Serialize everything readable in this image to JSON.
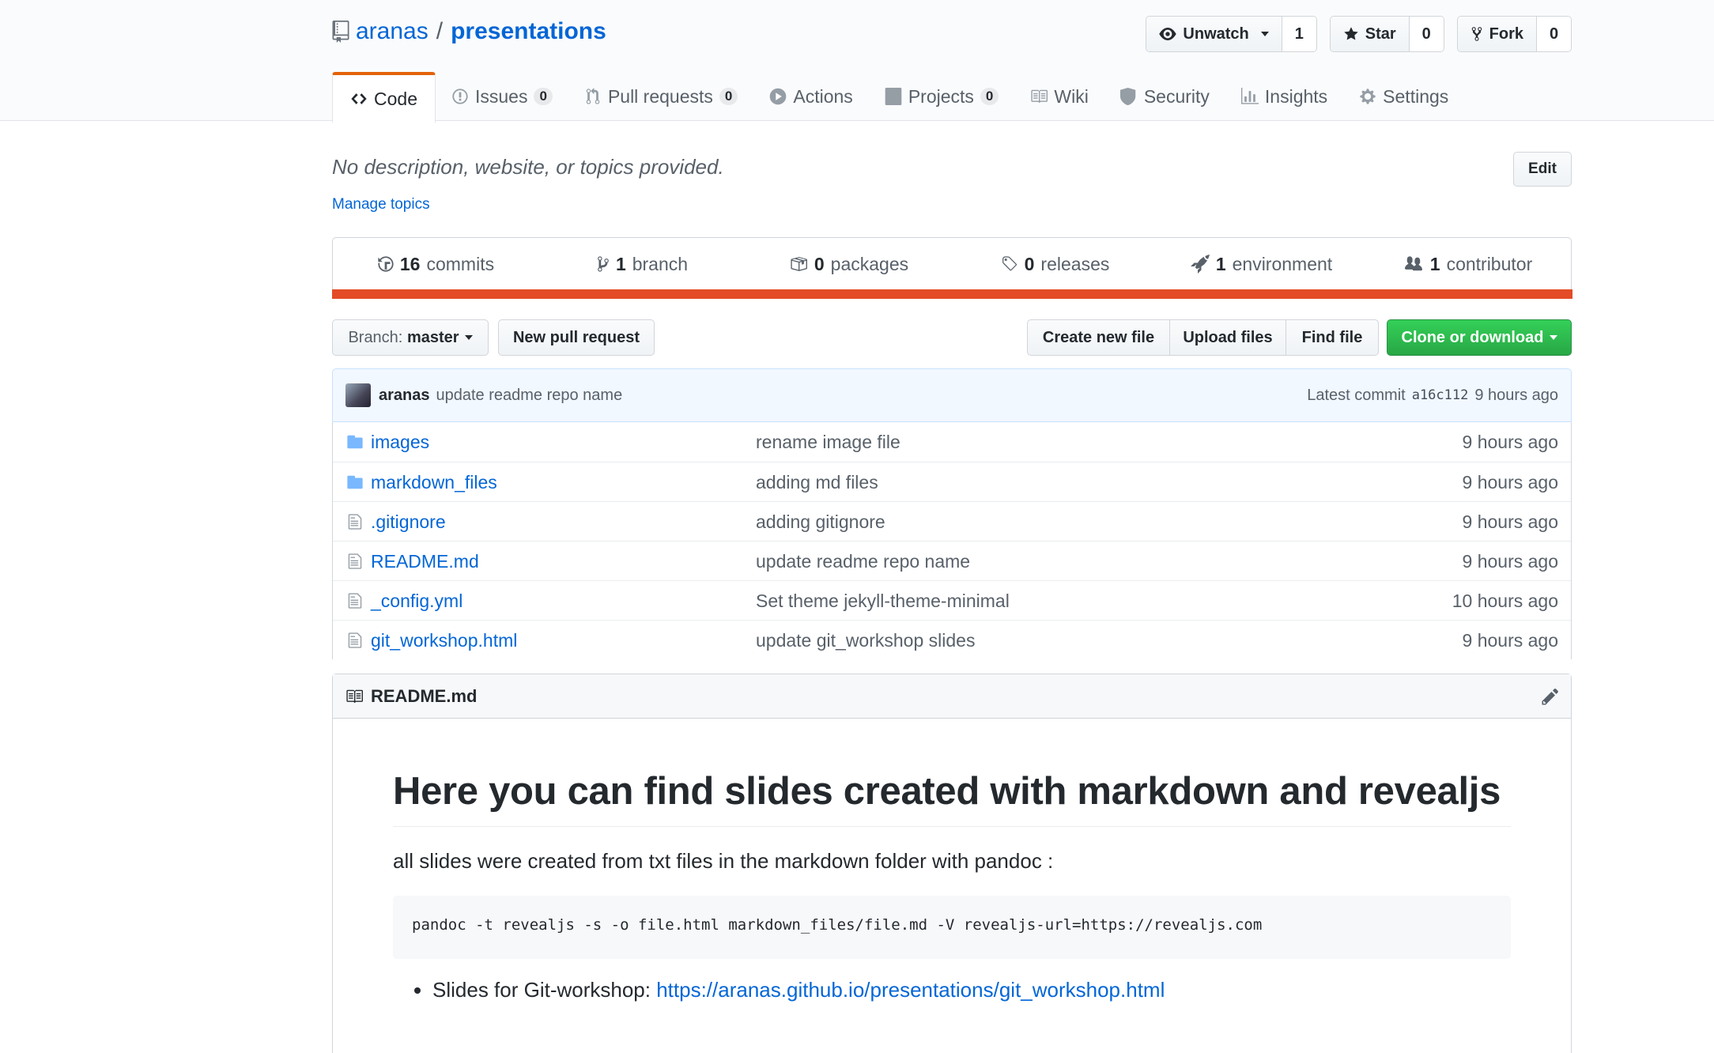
{
  "repo": {
    "owner": "aranas",
    "separator": "/",
    "name": "presentations"
  },
  "actions": {
    "watch": {
      "label": "Unwatch",
      "count": "1"
    },
    "star": {
      "label": "Star",
      "count": "0"
    },
    "fork": {
      "label": "Fork",
      "count": "0"
    }
  },
  "nav": {
    "code": "Code",
    "issues": "Issues",
    "issues_count": "0",
    "pulls": "Pull requests",
    "pulls_count": "0",
    "actions": "Actions",
    "projects": "Projects",
    "projects_count": "0",
    "wiki": "Wiki",
    "security": "Security",
    "insights": "Insights",
    "settings": "Settings"
  },
  "description": "No description, website, or topics provided.",
  "manage_topics": "Manage topics",
  "edit_label": "Edit",
  "summary": {
    "commits_num": "16",
    "commits_label": "commits",
    "branch_num": "1",
    "branch_label": "branch",
    "packages_num": "0",
    "packages_label": "packages",
    "releases_num": "0",
    "releases_label": "releases",
    "environment_num": "1",
    "environment_label": "environment",
    "contributor_num": "1",
    "contributor_label": "contributor",
    "lang_color": "#e34c26"
  },
  "file_nav": {
    "branch_prefix": "Branch:",
    "branch_name": "master",
    "new_pr": "New pull request",
    "create_file": "Create new file",
    "upload_files": "Upload files",
    "find_file": "Find file",
    "clone": "Clone or download"
  },
  "commit": {
    "author": "aranas",
    "message": "update readme repo name",
    "latest_label": "Latest commit",
    "sha": "a16c112",
    "age": "9 hours ago"
  },
  "files": [
    {
      "type": "dir",
      "name": "images",
      "message": "rename image file",
      "age": "9 hours ago"
    },
    {
      "type": "dir",
      "name": "markdown_files",
      "message": "adding md files",
      "age": "9 hours ago"
    },
    {
      "type": "file",
      "name": ".gitignore",
      "message": "adding gitignore",
      "age": "9 hours ago"
    },
    {
      "type": "file",
      "name": "README.md",
      "message": "update readme repo name",
      "age": "9 hours ago"
    },
    {
      "type": "file",
      "name": "_config.yml",
      "message": "Set theme jekyll-theme-minimal",
      "age": "10 hours ago"
    },
    {
      "type": "file",
      "name": "git_workshop.html",
      "message": "update git_workshop slides",
      "age": "9 hours ago"
    }
  ],
  "readme": {
    "filename": "README.md",
    "heading": "Here you can find slides created with markdown and revealjs",
    "paragraph": "all slides were created from txt files in the markdown folder with pandoc :",
    "code": "pandoc -t revealjs -s -o file.html markdown_files/file.md -V revealjs-url=https://revealjs.com",
    "list_prefix": "Slides for Git-workshop:",
    "list_link": "https://aranas.github.io/presentations/git_workshop.html"
  }
}
